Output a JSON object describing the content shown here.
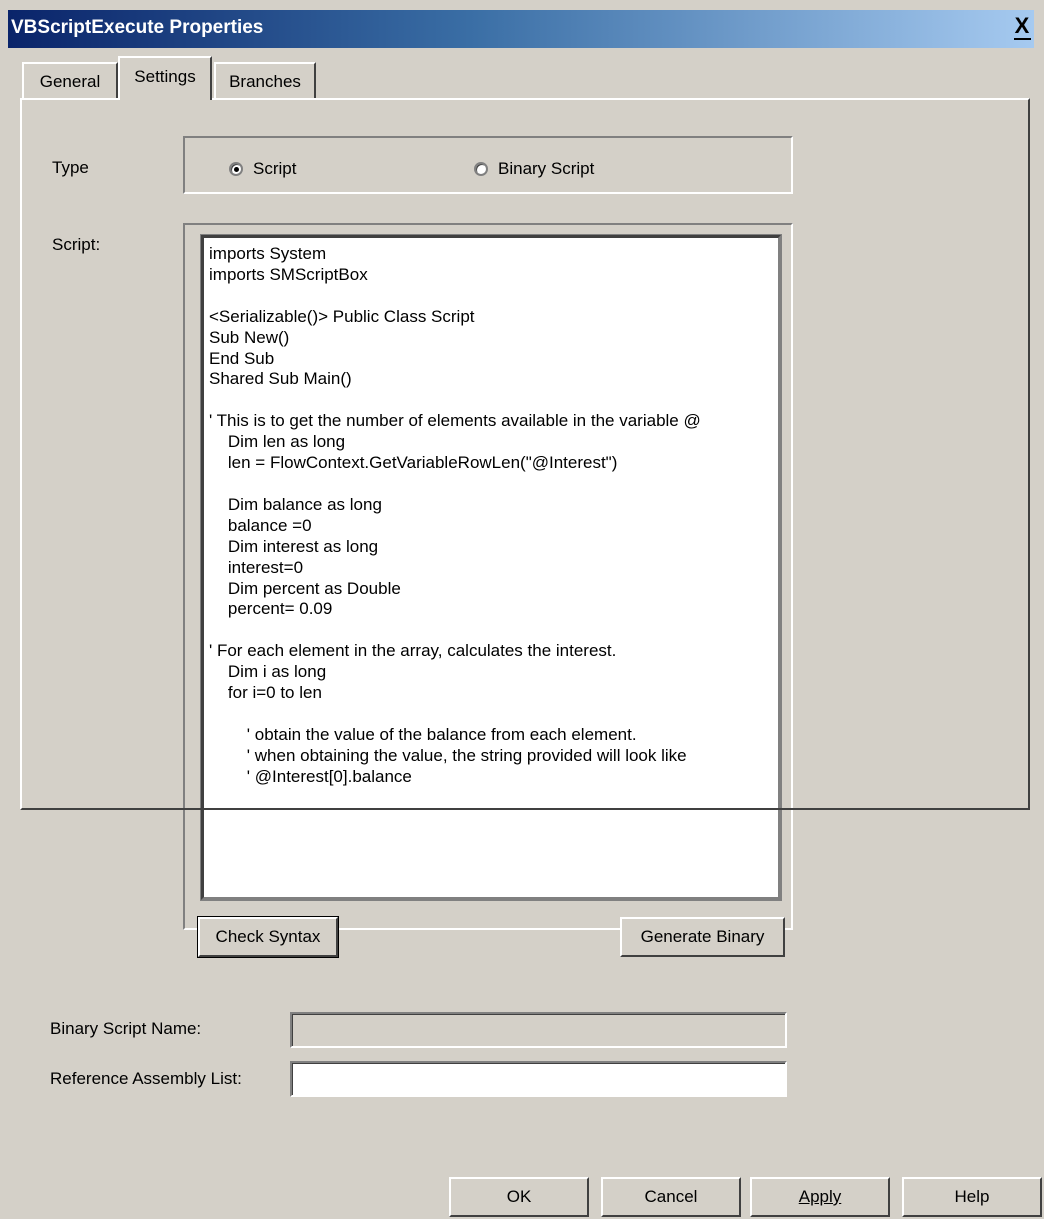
{
  "window": {
    "title": "VBScriptExecute Properties",
    "close_glyph": "X"
  },
  "tabs": [
    {
      "label": "General",
      "active": false
    },
    {
      "label": "Settings",
      "active": true
    },
    {
      "label": "Branches",
      "active": false
    }
  ],
  "type_section": {
    "label": "Type",
    "options": [
      {
        "label": "Script",
        "checked": true
      },
      {
        "label": "Binary Script",
        "checked": false
      }
    ]
  },
  "script_section": {
    "label": "Script:",
    "code": "imports System\nimports SMScriptBox\n\n<Serializable()> Public Class Script\nSub New()\nEnd Sub\nShared Sub Main()\n\n' This is to get the number of elements available in the variable @\n    Dim len as long\n    len = FlowContext.GetVariableRowLen(\"@Interest\")\n\n    Dim balance as long\n    balance =0\n    Dim interest as long\n    interest=0\n    Dim percent as Double\n    percent= 0.09\n\n' For each element in the array, calculates the interest.\n    Dim i as long\n    for i=0 to len\n\n        ' obtain the value of the balance from each element.\n        ' when obtaining the value, the string provided will look like\n        ' @Interest[0].balance",
    "check_syntax_label": "Check Syntax",
    "generate_binary_label": "Generate Binary"
  },
  "binary_script_name": {
    "label": "Binary Script Name:",
    "value": ""
  },
  "reference_assembly_list": {
    "label": "Reference Assembly List:",
    "value": ""
  },
  "footer": {
    "ok_label": "OK",
    "cancel_label": "Cancel",
    "apply_label": "Apply",
    "help_label": "Help"
  },
  "colors": {
    "dialog_bg": "#d4d0c8",
    "titlebar_start": "#0a246a",
    "titlebar_end": "#a6caf0"
  }
}
